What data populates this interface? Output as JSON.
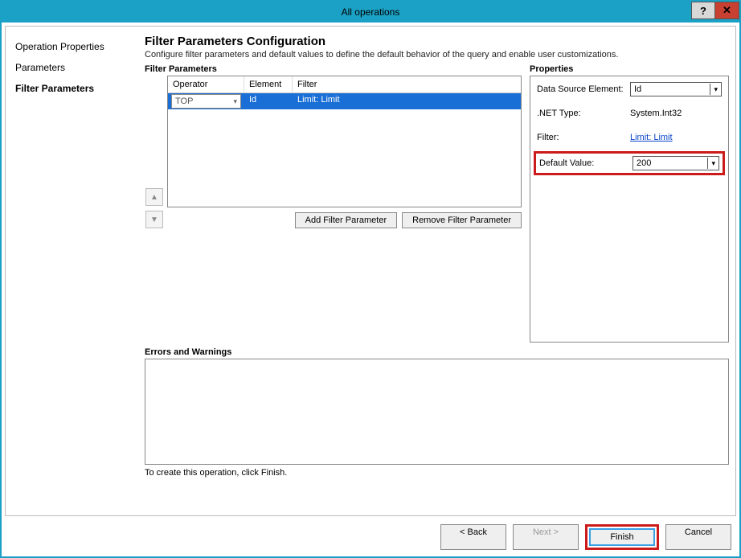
{
  "window": {
    "title": "All operations"
  },
  "sidebar": {
    "items": [
      {
        "label": "Operation Properties",
        "active": false
      },
      {
        "label": "Parameters",
        "active": false
      },
      {
        "label": "Filter Parameters",
        "active": true
      }
    ]
  },
  "main": {
    "title": "Filter Parameters Configuration",
    "subtitle": "Configure filter parameters and default values to define the default behavior of the query and enable user customizations.",
    "filter_params_label": "Filter Parameters",
    "grid_headers": {
      "operator": "Operator",
      "element": "Element",
      "filter": "Filter"
    },
    "grid_rows": [
      {
        "operator": "TOP",
        "element": "Id",
        "filter": "Limit: Limit"
      }
    ],
    "add_filter_btn": "Add Filter Parameter",
    "remove_filter_btn": "Remove Filter Parameter",
    "properties_label": "Properties",
    "props": {
      "data_source_label": "Data Source Element:",
      "data_source_value": "Id",
      "net_type_label": ".NET Type:",
      "net_type_value": "System.Int32",
      "filter_label": "Filter:",
      "filter_value": "Limit: Limit",
      "default_value_label": "Default Value:",
      "default_value": "200"
    },
    "errors_label": "Errors and Warnings",
    "hint": "To create this operation, click Finish."
  },
  "footer": {
    "back": "< Back",
    "next": "Next >",
    "finish": "Finish",
    "cancel": "Cancel"
  }
}
